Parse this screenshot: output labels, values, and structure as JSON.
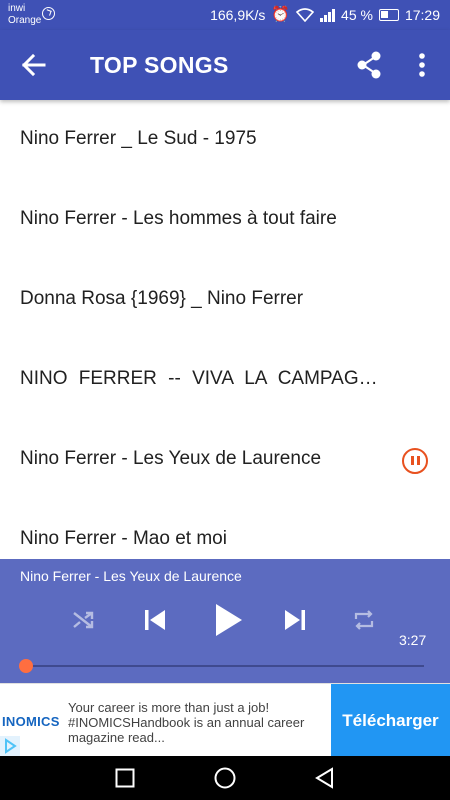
{
  "status_bar": {
    "carrier_line1": "inwi",
    "carrier_line2": "Orange",
    "net_speed": "166,9K/s",
    "battery_percent": "45 %",
    "time": "17:29"
  },
  "app_bar": {
    "title": "TOP SONGS",
    "color": "#3f51b5"
  },
  "songs": [
    {
      "title": "Nino Ferrer _ Le Sud  - 1975"
    },
    {
      "title": "Nino Ferrer - Les hommes à tout faire"
    },
    {
      "title": "Donna Rosa {1969} _ Nino Ferrer"
    },
    {
      "title": "NINO FERRER -- VIVA LA CAMPAGNE"
    },
    {
      "title": "Nino Ferrer - Les Yeux de Laurence",
      "state": "playing"
    },
    {
      "title": "Nino Ferrer - Mao et moi"
    }
  ],
  "player": {
    "now_playing": "Nino Ferrer - Les Yeux de Laurence",
    "duration": "3:27",
    "progress": 0,
    "panel_color": "#5c6bc0",
    "accent_color": "#ff6e40"
  },
  "ad": {
    "brand": "INOMICS",
    "text": "Your career is more than just a job! #INOMICSHandbook is an annual career magazine read...",
    "cta": "Télécharger",
    "cta_color": "#2196f3"
  }
}
